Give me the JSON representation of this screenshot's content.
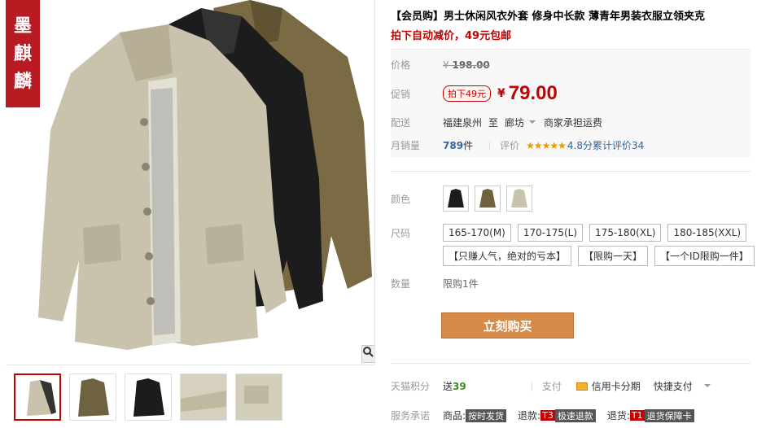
{
  "brand": {
    "seal": [
      "墨",
      "麒",
      "麟"
    ]
  },
  "product": {
    "title": "【会员购】男士休闲风衣外套 修身中长款 薄青年男装衣服立领夹克",
    "subtitle": "拍下自动减价，49元包邮"
  },
  "price": {
    "label": "价格",
    "original_prefix": "¥",
    "original": "198.00",
    "promo_label": "促销",
    "promo_tag": "拍下49元",
    "yen": "¥",
    "current": "79.00"
  },
  "shipping": {
    "label": "配送",
    "origin": "福建泉州",
    "to": "至",
    "dest": "廊坊",
    "note": "商家承担运费"
  },
  "sales": {
    "label": "月销量",
    "count": "789",
    "unit": "件",
    "rating_label": "评价",
    "stars": "★★★★★",
    "rating_text": "4.8分累计评价34"
  },
  "color": {
    "label": "颜色",
    "options": [
      {
        "name": "black"
      },
      {
        "name": "olive"
      },
      {
        "name": "khaki"
      }
    ]
  },
  "size": {
    "label": "尺码",
    "options": [
      "165-170(M)",
      "170-175(L)",
      "175-180(XL)",
      "180-185(XXL)"
    ],
    "tags": [
      "【只赚人气，绝对的亏本】",
      "【限购一天】",
      "【一个ID限购一件】"
    ]
  },
  "quantity": {
    "label": "数量",
    "limit": "限购1件"
  },
  "buy": {
    "label": "立刻购买"
  },
  "points": {
    "label": "天猫积分",
    "text": "送",
    "value": "39",
    "pay_label": "支付",
    "installment": "信用卡分期",
    "quickpay": "快捷支付"
  },
  "service": {
    "label": "服务承诺",
    "goods": "商品:",
    "goods_badge": "按时发货",
    "refund": "退款:",
    "refund_badge_code": "T3",
    "refund_badge": "极速退款",
    "return": "退货:",
    "return_badge_code": "T1",
    "return_badge": "退货保障卡"
  },
  "colors": {
    "accent": "#c40000",
    "buy_button": "#d68a48",
    "link": "#336699",
    "star": "#e89c00"
  }
}
